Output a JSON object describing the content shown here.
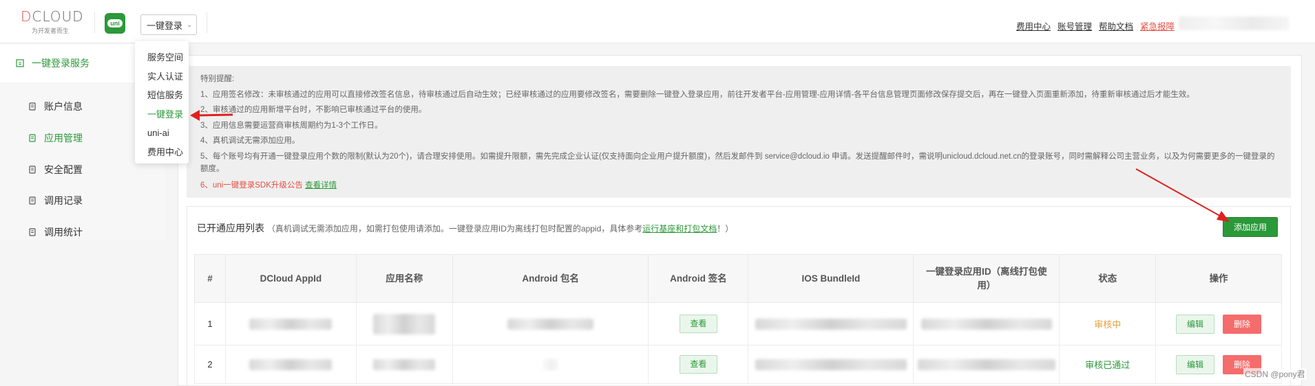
{
  "header": {
    "logo_text_a": "D",
    "logo_text_b": "CLOUD",
    "logo_tagline": "为开发者而生",
    "app_icon_text": "uni",
    "service_select": "一键登录",
    "links": [
      "费用中心",
      "账号管理",
      "帮助文档",
      "紧急报障"
    ]
  },
  "dropdown": {
    "items": [
      "服务空间",
      "实人认证",
      "短信服务",
      "一键登录",
      "uni-ai",
      "费用中心"
    ],
    "active_index": 3
  },
  "sidebar": {
    "group": "一键登录服务",
    "items": [
      "账户信息",
      "应用管理",
      "安全配置",
      "调用记录",
      "调用统计"
    ],
    "active_index": 1
  },
  "notice": {
    "title": "特别提醒:",
    "l1": "1、应用签名修改：未审核通过的应用可以直接修改签名信息，待审核通过后自动生效；已经审核通过的应用要修改签名，需要删除一键登入登录应用，前往开发者平台-应用管理-应用详情-各平台信息管理页面修改保存提交后，再在一键登入页面重新添加，待重新审核通过后才能生效。",
    "l2": "2、审核通过的应用新增平台时，不影响已审核通过平台的使用。",
    "l3": "3、应用信息需要运营商审核周期约为1-3个工作日。",
    "l4": "4、真机调试无需添加应用。",
    "l5": "5、每个账号均有开通一键登录应用个数的限制(默认为20个)，请合理安排使用。如需提升限额，需先完成企业认证(仅支持面向企业用户提升额度)，然后发邮件到 service@dcloud.io 申请。发送提醒邮件时，需说明unicloud.dcloud.net.cn的登录账号，同时需解释公司主营业务，以及为何需要更多的一键登录的额度。",
    "l6": "6、uni一键登录SDK升级公告",
    "l6_link": "查看详情"
  },
  "list": {
    "title": "已开通应用列表",
    "sub_a": "（真机调试无需添加应用，如需打包使用请添加。一键登录应用ID为离线打包时配置的appid，具体参考",
    "sub_link": "运行基座和打包文档",
    "sub_b": "！）",
    "add_button": "添加应用",
    "columns": [
      "#",
      "DCloud AppId",
      "应用名称",
      "Android 包名",
      "Android 签名",
      "IOS BundleId",
      "一键登录应用ID（离线打包使用）",
      "状态",
      "操作"
    ],
    "rows": [
      {
        "index": "1",
        "sign_btn": "查看",
        "status": "审核中",
        "status_type": "pending",
        "edit": "编辑",
        "delete": "删除"
      },
      {
        "index": "2",
        "sign_btn": "查看",
        "status": "审核已通过",
        "status_type": "pass",
        "edit": "编辑",
        "delete": "删除"
      }
    ]
  },
  "watermark": "CSDN @pony君",
  "colors": {
    "brand_green": "#2b9939",
    "danger_red": "#f56c6c",
    "warning_orange": "#e6a23c",
    "annotation_red": "#e02020"
  }
}
